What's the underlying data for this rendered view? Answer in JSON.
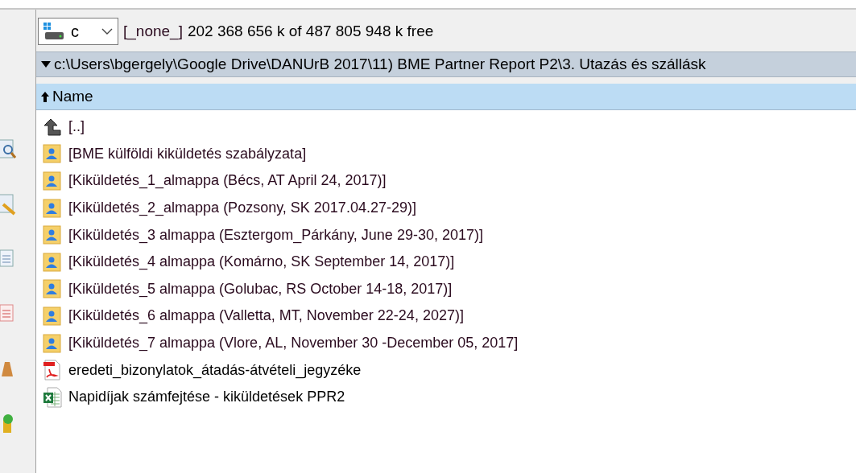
{
  "drive": {
    "letter": "c",
    "label": "[_none_]",
    "free_space": "202 368 656 k of 487 805 948 k free"
  },
  "path": {
    "text": "c:\\Users\\bgergely\\Google Drive\\DANUrB 2017\\11) BME Partner Report P2\\3. Utazás és szállásk"
  },
  "columns": [
    {
      "label": "Name",
      "sort_ascending": true
    }
  ],
  "sidebar_icons": [
    {
      "kind": "search"
    },
    {
      "kind": "edit"
    },
    {
      "kind": "document"
    },
    {
      "kind": "pdf"
    },
    {
      "kind": "pack"
    },
    {
      "kind": "add"
    }
  ],
  "files": [
    {
      "kind": "up",
      "name": "[..]"
    },
    {
      "kind": "shared-folder",
      "name": "[BME külföldi kiküldetés szabályzata]"
    },
    {
      "kind": "shared-folder",
      "name": "[Kiküldetés_1_almappa (Bécs, AT April 24, 2017)]"
    },
    {
      "kind": "shared-folder",
      "name": "[Kiküldetés_2_almappa (Pozsony, SK 2017.04.27-29)]"
    },
    {
      "kind": "shared-folder",
      "name": "[Kiküldetés_3 almappa (Esztergom_Párkány, June 29-30, 2017)]"
    },
    {
      "kind": "shared-folder",
      "name": "[Kiküldetés_4 almappa (Komárno, SK September 14, 2017)]"
    },
    {
      "kind": "shared-folder",
      "name": "[Kiküldetés_5 almappa (Golubac, RS October 14-18, 2017)]"
    },
    {
      "kind": "shared-folder",
      "name": "[Kiküldetés_6 almappa (Valletta, MT, November 22-24, 2027)]"
    },
    {
      "kind": "shared-folder",
      "name": "[Kiküldetés_7 almappa (Vlore, AL, November 30 -December 05, 2017]"
    },
    {
      "kind": "pdf",
      "name": "eredeti_bizonylatok_átadás-átvételi_jegyzéke"
    },
    {
      "kind": "excel",
      "name": "Napidíjak számfejtése - kiküldetések PPR2"
    }
  ]
}
